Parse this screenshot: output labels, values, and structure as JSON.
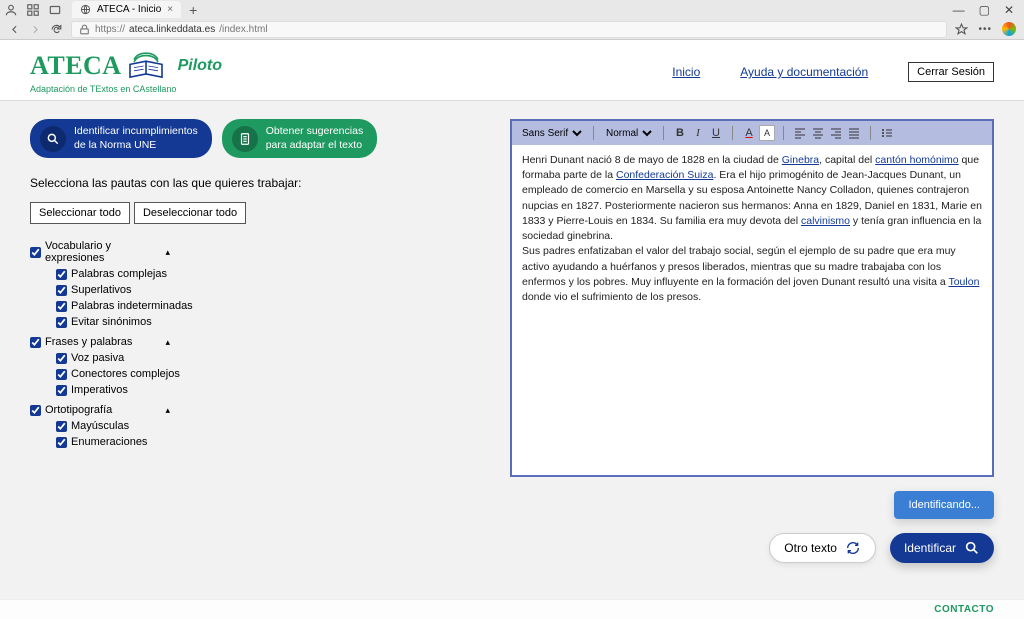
{
  "browser": {
    "tab_title": "ATECA - Inicio",
    "url_host": "ateca.linkeddata.es",
    "url_path": "/index.html",
    "url_prefix": "https://"
  },
  "header": {
    "logo": "ATECA",
    "piloto": "Piloto",
    "tagline": "Adaptación de TExtos en CAstellano",
    "nav_inicio": "Inicio",
    "nav_ayuda": "Ayuda y documentación",
    "logout": "Cerrar Sesión"
  },
  "actions": {
    "identify_l1": "Identificar incumplimientos",
    "identify_l2": "de la Norma UNE",
    "suggest_l1": "Obtener sugerencias",
    "suggest_l2": "para adaptar el texto"
  },
  "instruction": "Selecciona las pautas con las que quieres trabajar:",
  "sel_all": "Seleccionar todo",
  "desel_all": "Deseleccionar todo",
  "groups": [
    {
      "label": "Vocabulario y expresiones",
      "items": [
        "Palabras complejas",
        "Superlativos",
        "Palabras indeterminadas",
        "Evitar sinónimos"
      ]
    },
    {
      "label": "Frases y palabras",
      "items": [
        "Voz pasiva",
        "Conectores complejos",
        "Imperativos"
      ]
    },
    {
      "label": "Ortotipografía",
      "items": [
        "Mayúsculas",
        "Enumeraciones"
      ]
    }
  ],
  "editor": {
    "font": "Sans Serif",
    "size": "Normal",
    "text1a": "Henri Dunant nació 8 de mayo de 1828 en la ciudad de ",
    "link_ginebra": "Ginebra",
    "text1b": ", capital del ",
    "link_canton": "cantón homónimo",
    "text1c": " que formaba parte de la ",
    "link_conf": "Confederación Suiza",
    "text1d": ". Era el hijo primogénito de Jean-Jacques Dunant, un empleado de comercio en Marsella y su esposa Antoinette Nancy Colladon, quienes contrajeron nupcias en 1827. Posteriormente nacieron sus hermanos: Anna en 1829, Daniel en 1831, Marie en 1833 y Pierre-Louis en 1834. Su familia era muy devota del ",
    "link_calv": "calvinismo",
    "text1e": " y tenía gran influencia en la sociedad ginebrina.",
    "text2a": "Sus padres enfatizaban el valor del trabajo social, según el ejemplo de su padre que era muy activo ayudando a huérfanos y presos liberados, mientras que su madre trabajaba con los enfermos y los pobres. Muy influyente en la formación del joven Dunant resultó una visita a ",
    "link_toulon": "Toulon",
    "text2b": " donde vio el sufrimiento de los presos."
  },
  "status": "Identificando...",
  "btn_otro": "Otro texto",
  "btn_ident": "Identificar",
  "footer_contact": "CONTACTO"
}
